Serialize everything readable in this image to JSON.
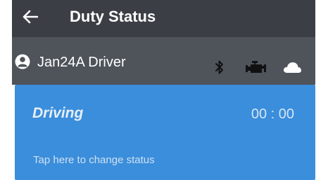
{
  "header": {
    "title": "Duty Status",
    "back_icon": "arrow-left-icon"
  },
  "driver": {
    "name": "Jan24A Driver",
    "avatar_icon": "user-avatar-icon",
    "indicators": [
      "bluetooth-icon",
      "engine-icon",
      "cloud-icon"
    ]
  },
  "status": {
    "name": "Driving",
    "timer": "00 : 00",
    "hint": "Tap here to change status",
    "color": "#3a8edb"
  },
  "colors": {
    "appbar": "#3b3f45",
    "driver_bar": "#4f545b"
  }
}
